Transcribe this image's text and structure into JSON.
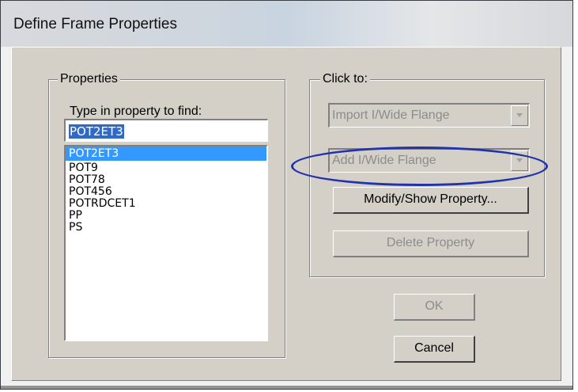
{
  "window": {
    "title": "Define Frame Properties"
  },
  "properties": {
    "group_label": "Properties",
    "find_label": "Type in property to find:",
    "find_value": "POT2ET3",
    "items": [
      "POT2ET3",
      "POT9",
      "POT78",
      "POT456",
      "POTRDCET1",
      "PP",
      "PS"
    ],
    "selected_index": 0
  },
  "click_to": {
    "group_label": "Click to:",
    "import_combo": "Import I/Wide Flange",
    "add_combo": "Add I/Wide Flange",
    "modify_button": "Modify/Show Property...",
    "delete_button": "Delete Property"
  },
  "buttons": {
    "ok": "OK",
    "cancel": "Cancel"
  },
  "colors": {
    "selection": "#3399ff",
    "annotation": "#2233aa"
  }
}
